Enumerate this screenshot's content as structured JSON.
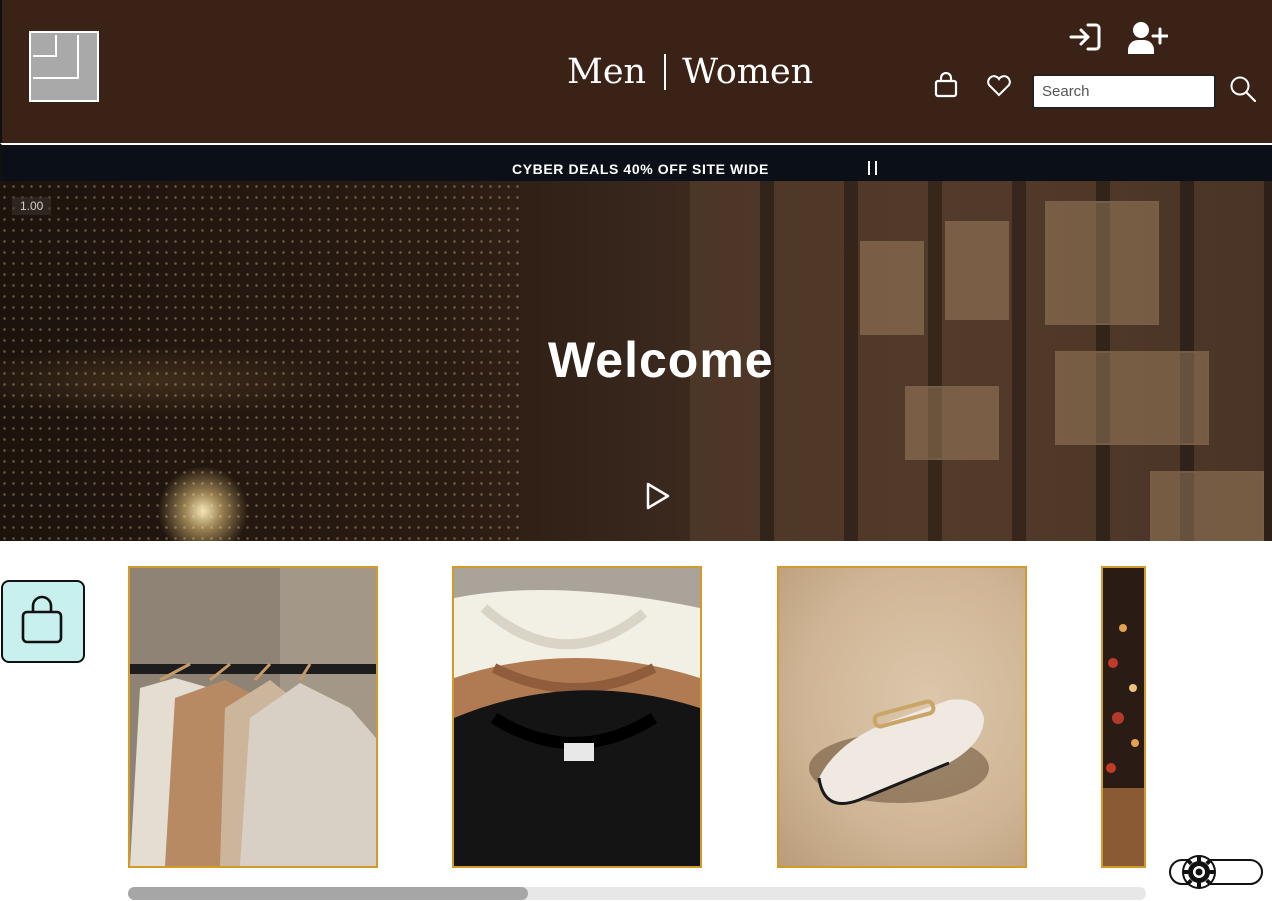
{
  "header": {
    "logo_icon": "logo-squares-icon",
    "nav": {
      "men_label": "Men",
      "women_label": "Women"
    },
    "icons": {
      "login": "sign-in-icon",
      "register": "add-user-icon",
      "cart": "shopping-bag-icon",
      "wishlist": "heart-icon",
      "search": "magnifier-icon"
    },
    "search": {
      "placeholder": "Search",
      "value": ""
    }
  },
  "promo": {
    "text": "CYBER DEALS 40% OFF SITE WIDE",
    "control_icon": "pause-icon"
  },
  "hero": {
    "speed_label": "1.00",
    "heading": "Welcome",
    "play_icon": "play-icon"
  },
  "floating_cart": {
    "icon": "shopping-bag-icon"
  },
  "carousel": {
    "items": [
      {
        "image": "clothes-on-hangers"
      },
      {
        "image": "folded-sweatshirts"
      },
      {
        "image": "white-loafer-shoe"
      },
      {
        "image": "christmas-tree-lights"
      }
    ],
    "scroll_position": 0.0
  },
  "accessibility_toggle": {
    "icon": "gear-icon",
    "state": "off"
  },
  "colors": {
    "header_bg": "#3b2216",
    "promo_bg": "#0b0f17",
    "card_border": "#d29a2a",
    "floating_cart_bg": "#c8f0ef"
  }
}
